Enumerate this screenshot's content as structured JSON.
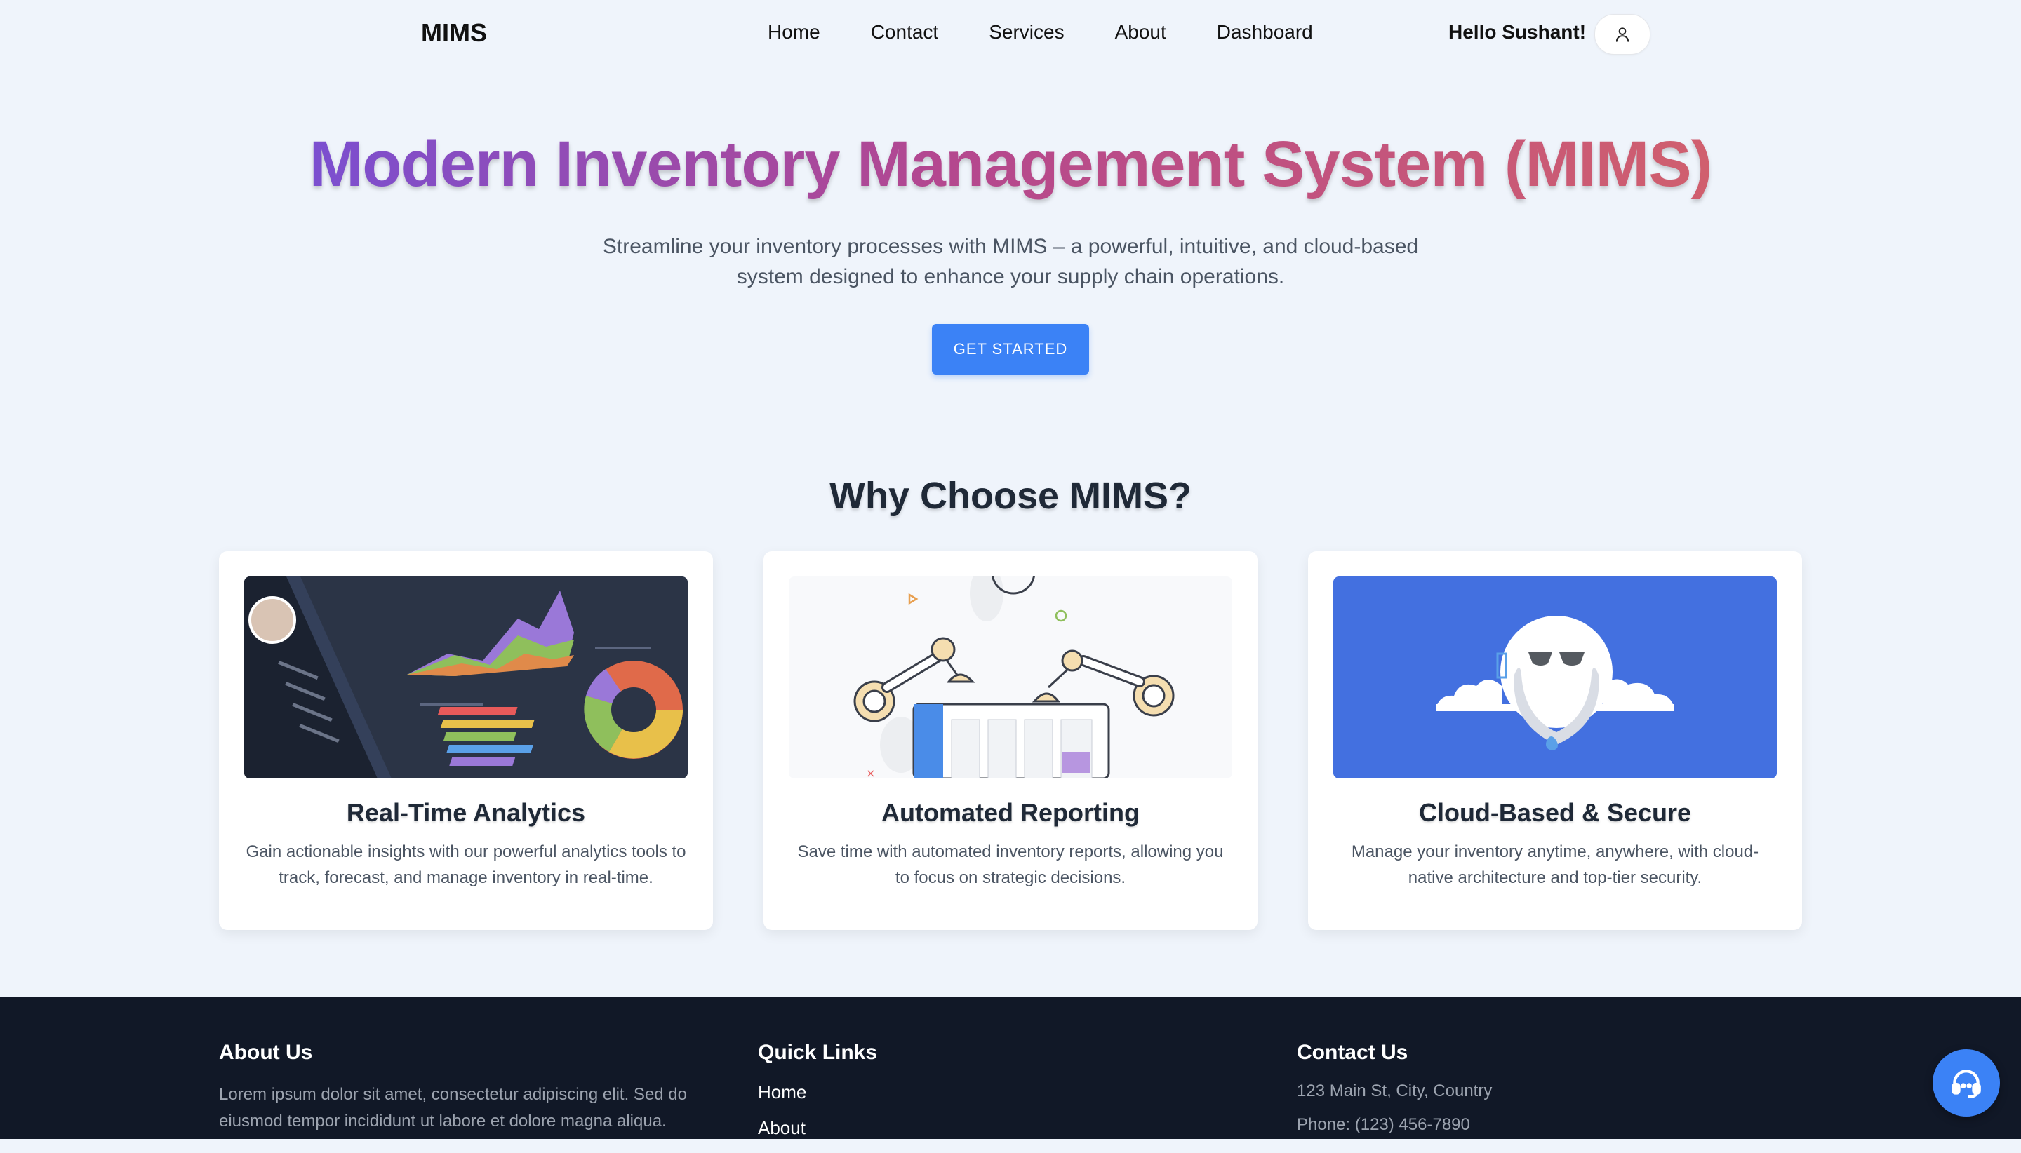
{
  "nav": {
    "brand": "MIMS",
    "links": [
      {
        "label": "Home"
      },
      {
        "label": "Contact"
      },
      {
        "label": "Services"
      },
      {
        "label": "About"
      },
      {
        "label": "Dashboard"
      }
    ],
    "greeting": "Hello Sushant!",
    "user_icon": "user-icon"
  },
  "hero": {
    "title": "Modern Inventory Management System (MIMS)",
    "subtitle": "Streamline your inventory processes with MIMS – a powerful, intuitive, and cloud-based system designed to enhance your supply chain operations.",
    "cta_label": "GET STARTED"
  },
  "features": {
    "title": "Why Choose MIMS?",
    "cards": [
      {
        "title": "Real-Time Analytics",
        "description": "Gain actionable insights with our powerful analytics tools to track, forecast, and manage inventory in real-time."
      },
      {
        "title": "Automated Reporting",
        "description": "Save time with automated inventory reports, allowing you to focus on strategic decisions."
      },
      {
        "title": "Cloud-Based & Secure",
        "description": "Manage your inventory anytime, anywhere, with cloud-native architecture and top-tier security."
      }
    ]
  },
  "footer": {
    "about": {
      "title": "About Us",
      "text": "Lorem ipsum dolor sit amet, consectetur adipiscing elit. Sed do eiusmod tempor incididunt ut labore et dolore magna aliqua."
    },
    "quick_links": {
      "title": "Quick Links",
      "links": [
        "Home",
        "About"
      ]
    },
    "contact": {
      "title": "Contact Us",
      "address": "123 Main St, City, Country",
      "phone": "Phone: (123) 456-7890"
    }
  },
  "colors": {
    "accent": "#3b82f6",
    "footer_bg": "#111827",
    "page_bg": "#eff4fb"
  }
}
